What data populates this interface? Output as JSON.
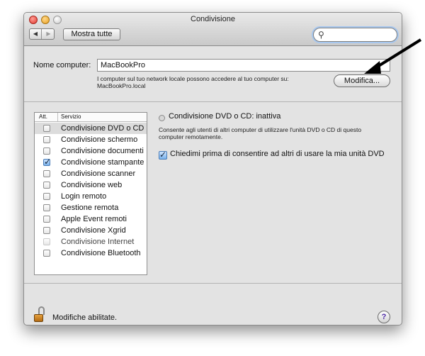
{
  "window": {
    "title": "Condivisione"
  },
  "toolbar": {
    "back_glyph": "◀",
    "forward_glyph": "▶",
    "show_all_label": "Mostra tutte",
    "search_value": "",
    "search_icon": "search-icon"
  },
  "host": {
    "label": "Nome computer:",
    "value": "MacBookPro",
    "description": "I computer sul tuo network locale possono accedere al tuo computer su: MacBookPro.local",
    "edit_button": "Modifica..."
  },
  "service_list": {
    "header_att": "Att.",
    "header_service": "Servizio",
    "rows": [
      {
        "label": "Condivisione DVD o CD",
        "checked": false,
        "selected": true,
        "disabled": false
      },
      {
        "label": "Condivisione schermo",
        "checked": false,
        "selected": false,
        "disabled": false
      },
      {
        "label": "Condivisione documenti",
        "checked": false,
        "selected": false,
        "disabled": false
      },
      {
        "label": "Condivisione stampante",
        "checked": true,
        "selected": false,
        "disabled": false
      },
      {
        "label": "Condivisione scanner",
        "checked": false,
        "selected": false,
        "disabled": false
      },
      {
        "label": "Condivisione web",
        "checked": false,
        "selected": false,
        "disabled": false
      },
      {
        "label": "Login remoto",
        "checked": false,
        "selected": false,
        "disabled": false
      },
      {
        "label": "Gestione remota",
        "checked": false,
        "selected": false,
        "disabled": false
      },
      {
        "label": "Apple Event remoti",
        "checked": false,
        "selected": false,
        "disabled": false
      },
      {
        "label": "Condivisione Xgrid",
        "checked": false,
        "selected": false,
        "disabled": false
      },
      {
        "label": "Condivisione Internet",
        "checked": false,
        "selected": false,
        "disabled": true
      },
      {
        "label": "Condivisione Bluetooth",
        "checked": false,
        "selected": false,
        "disabled": false
      }
    ]
  },
  "detail": {
    "status_title": "Condivisione DVD o CD: inattiva",
    "description": "Consente agli utenti di altri computer di utilizzare l'unità DVD o CD di questo computer remotamente.",
    "ask_checkbox_checked": true,
    "ask_checkbox_label": "Chiedimi prima di consentire ad altri di usare la mia unità DVD"
  },
  "footer": {
    "lock_label": "Modifiche abilitate.",
    "help_glyph": "?"
  },
  "annotation": {
    "arrow_color": "#000000"
  }
}
